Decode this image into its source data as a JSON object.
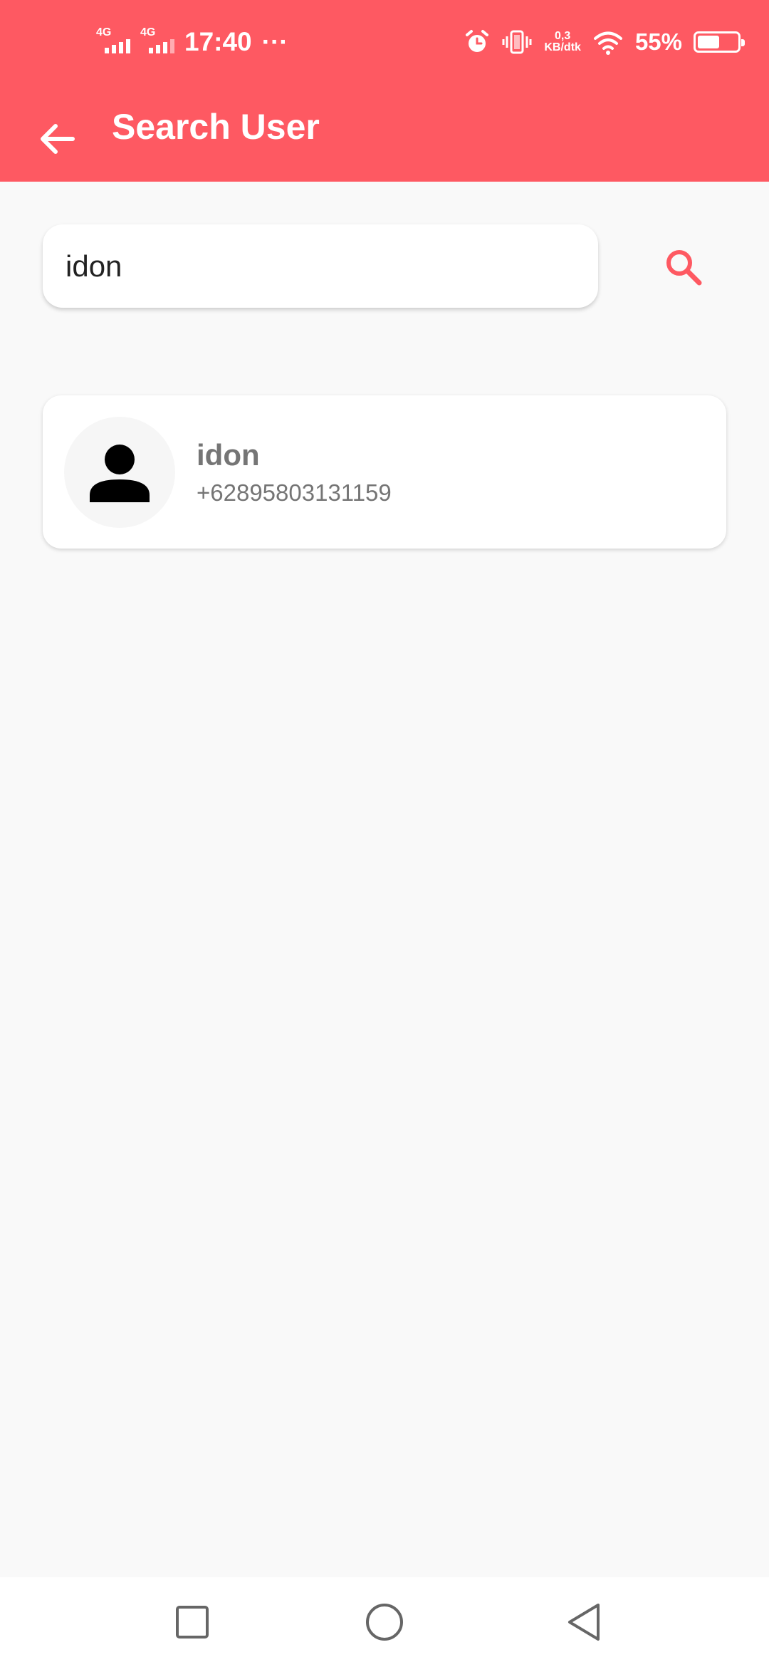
{
  "status_bar": {
    "network_1": "4G",
    "network_2": "4G",
    "time": "17:40",
    "more": "···",
    "speed_value": "0,3",
    "speed_unit": "KB/dtk",
    "battery": "55%",
    "battery_level": 0.55
  },
  "toolbar": {
    "title": "Search User",
    "back_icon": "arrow-left-icon"
  },
  "search": {
    "value": "idon",
    "placeholder": "",
    "button_icon": "search-icon"
  },
  "results": [
    {
      "name": "idon",
      "phone": "+62895803131159",
      "avatar_icon": "person-icon"
    }
  ],
  "nav": {
    "recents_icon": "square-icon",
    "home_icon": "circle-icon",
    "back_icon": "triangle-back-icon"
  },
  "colors": {
    "accent": "#fe5962",
    "background": "#f9f9f9",
    "text_secondary": "#757575"
  }
}
